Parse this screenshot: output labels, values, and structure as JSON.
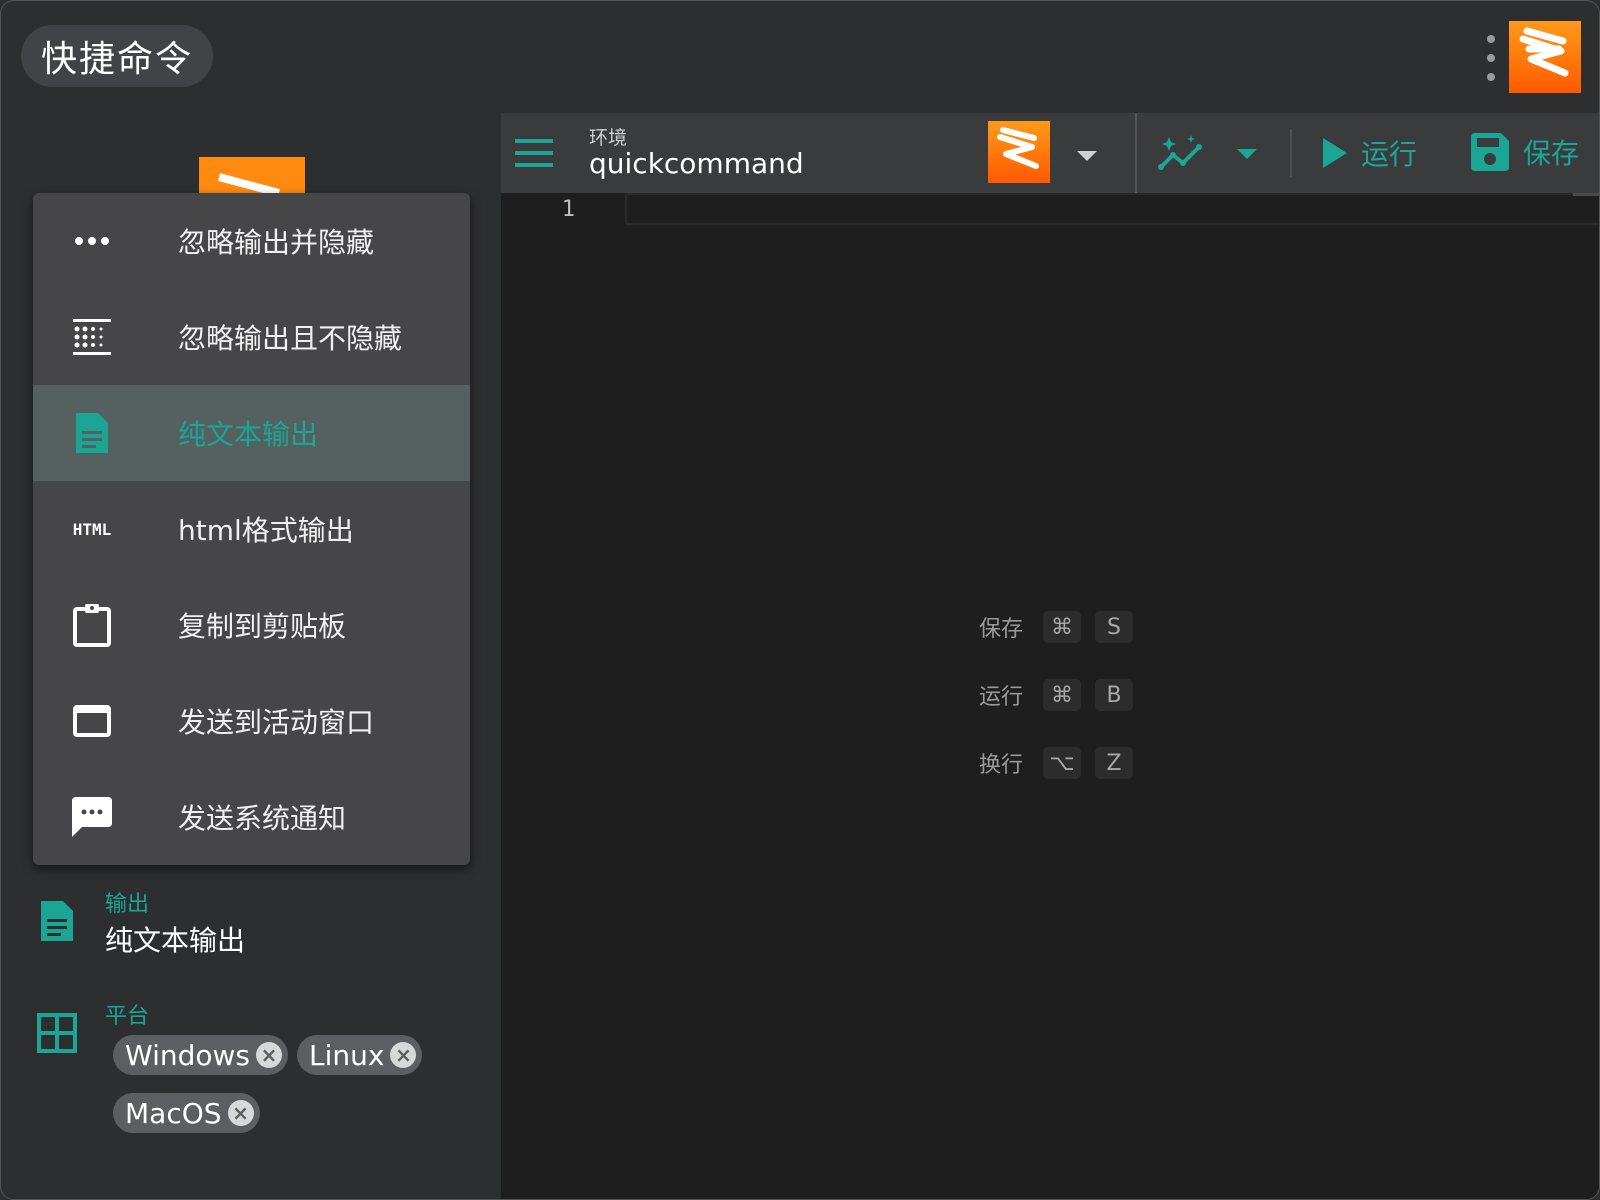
{
  "app": {
    "title": "快捷命令"
  },
  "toolbar": {
    "env_label": "环境",
    "env_value": "quickcommand",
    "run_label": "运行",
    "save_label": "保存"
  },
  "editor": {
    "line_numbers": [
      "1"
    ]
  },
  "shortcuts": [
    {
      "label": "保存",
      "mod": "⌘",
      "key": "S"
    },
    {
      "label": "运行",
      "mod": "⌘",
      "key": "B"
    },
    {
      "label": "换行",
      "mod": "⌥",
      "key": "Z"
    }
  ],
  "output_menu": {
    "items": [
      {
        "label": "忽略输出并隐藏",
        "icon": "more-horiz-icon"
      },
      {
        "label": "忽略输出且不隐藏",
        "icon": "blur-dots-icon"
      },
      {
        "label": "纯文本输出",
        "icon": "text-document-icon",
        "selected": true
      },
      {
        "label": "html格式输出",
        "icon": "html-icon",
        "icon_text": "HTML"
      },
      {
        "label": "复制到剪贴板",
        "icon": "clipboard-icon"
      },
      {
        "label": "发送到活动窗口",
        "icon": "window-icon"
      },
      {
        "label": "发送系统通知",
        "icon": "message-icon"
      }
    ]
  },
  "output_field": {
    "label": "输出",
    "value": "纯文本输出"
  },
  "platform_field": {
    "label": "平台",
    "chips": [
      "Windows",
      "Linux",
      "MacOS"
    ]
  },
  "colors": {
    "accent": "#1aa595",
    "background": "#2d2e30",
    "editor": "#1e1e1e",
    "menu": "#464648",
    "menu_selected": "#556060",
    "logo_orange": "#ff7a00"
  }
}
